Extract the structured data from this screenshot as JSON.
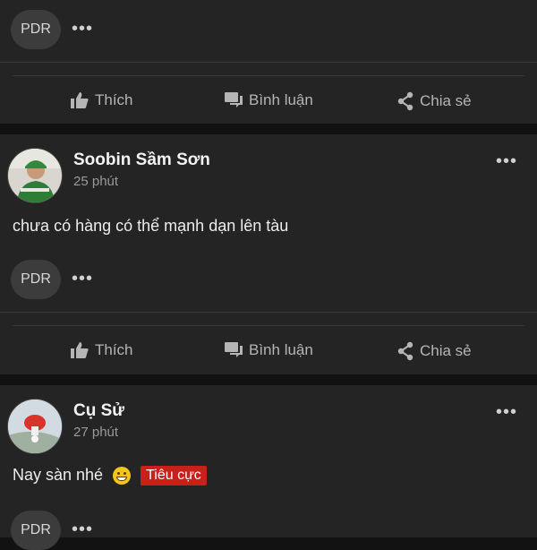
{
  "post_top": {
    "pill_label": "PDR",
    "actions": {
      "like": "Thích",
      "comment": "Bình luận",
      "share": "Chia sẻ"
    }
  },
  "post_soobin": {
    "author": "Soobin Sầm Sơn",
    "time": "25 phút",
    "content": "chưa có hàng có thể mạnh dạn lên tàu",
    "pill_label": "PDR",
    "actions": {
      "like": "Thích",
      "comment": "Bình luận",
      "share": "Chia sẻ"
    }
  },
  "post_cusu": {
    "author": "Cụ Sử",
    "time": "27 phút",
    "content": "Nay sàn nhé",
    "badge": "Tiêu cực",
    "pill_label": "PDR"
  },
  "icons": {
    "like": "thumbs-up-icon",
    "comment": "comment-icon",
    "share": "share-icon",
    "more": "more-dots-icon"
  },
  "colors": {
    "background": "#121212",
    "panel": "#242424",
    "badge": "#c8201a"
  }
}
